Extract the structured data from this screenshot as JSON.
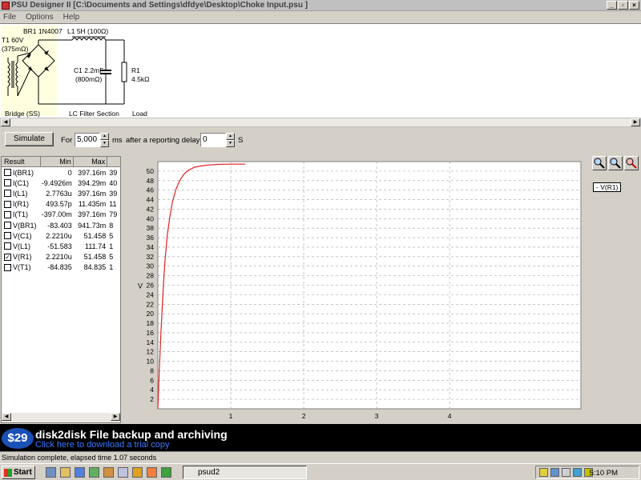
{
  "window": {
    "title": "PSU Designer II  [C:\\Documents and Settings\\dfdye\\Desktop\\Choke Input.psu ]",
    "minimize": "_",
    "maximize": "▫",
    "close": "×"
  },
  "menu": [
    "File",
    "Options",
    "Help"
  ],
  "schematic": {
    "transformer_label": "T1 60V",
    "transformer_resistance": "(375mΩ)",
    "rectifier_label": "BR1 1N4007",
    "inductor_label": "L1 5H (100Ω)",
    "capacitor_label": "C1 2.2mF",
    "capacitor_resistance": "(800mΩ)",
    "load_label": "R1",
    "load_value": "4.5kΩ",
    "section_bridge": "Bridge (SS)",
    "section_filter": "LC Filter Section",
    "section_load": "Load",
    "colors": {
      "bridge_highlight": "#ffffe0",
      "wire": "#000000"
    }
  },
  "simulation": {
    "simulate_button": "Simulate",
    "for_label": "For",
    "duration_value": "5,000",
    "ms_label": "ms",
    "delay_label": "after a reporting delay of",
    "delay_value": "0",
    "s_label": "S"
  },
  "results": {
    "headers": [
      "Result",
      "Min",
      "Max",
      ""
    ],
    "rows": [
      {
        "name": "I(BR1)",
        "min": "0",
        "max": "397.16m",
        "extra": "39",
        "checked": false
      },
      {
        "name": "I(C1)",
        "min": "-9.4926m",
        "max": "394.29m",
        "extra": "40",
        "checked": false
      },
      {
        "name": "I(L1)",
        "min": "2.7763u",
        "max": "397.16m",
        "extra": "39",
        "checked": false
      },
      {
        "name": "I(R1)",
        "min": "493.57p",
        "max": "11.435m",
        "extra": "11",
        "checked": false
      },
      {
        "name": "I(T1)",
        "min": "-397.00m",
        "max": "397.16m",
        "extra": "79",
        "checked": false
      },
      {
        "name": "V(BR1)",
        "min": "-83.403",
        "max": "941.73m",
        "extra": "8",
        "checked": false
      },
      {
        "name": "V(C1)",
        "min": "2.2210u",
        "max": "51.458",
        "extra": "5",
        "checked": false
      },
      {
        "name": "V(L1)",
        "min": "-51.583",
        "max": "111.74",
        "extra": "1",
        "checked": false
      },
      {
        "name": "V(R1)",
        "min": "2.2210u",
        "max": "51.458",
        "extra": "5",
        "checked": true
      },
      {
        "name": "V(T1)",
        "min": "-84.835",
        "max": "84.835",
        "extra": "1",
        "checked": false
      }
    ],
    "check_mark": "✓"
  },
  "zoom_buttons": [
    "zoom-in-icon",
    "zoom-out-icon",
    "zoom-reset-icon"
  ],
  "chart_data": {
    "type": "line",
    "ylabel": "V",
    "xlabel": "",
    "xlim": [
      0,
      5.8
    ],
    "ylim": [
      0,
      52
    ],
    "x_ticks": [
      1,
      2,
      3,
      4
    ],
    "y_ticks": [
      2,
      4,
      6,
      8,
      10,
      12,
      14,
      16,
      18,
      20,
      22,
      24,
      26,
      28,
      30,
      32,
      34,
      36,
      38,
      40,
      42,
      44,
      46,
      48,
      50
    ],
    "grid": true,
    "legend_position": "top-right",
    "series": [
      {
        "name": "V(R1)",
        "color": "#e02020",
        "x": [
          0,
          0.01,
          0.02,
          0.04,
          0.06,
          0.08,
          0.1,
          0.13,
          0.16,
          0.2,
          0.25,
          0.3,
          0.35,
          0.4,
          0.5,
          0.6,
          0.7,
          0.8,
          0.9,
          1.0,
          1.1,
          1.2
        ],
        "y": [
          0,
          4,
          8,
          15,
          21.5,
          27,
          31.5,
          36.5,
          40,
          43.5,
          46.3,
          48,
          49.2,
          50,
          50.8,
          51.1,
          51.3,
          51.4,
          51.45,
          51.46,
          51.46,
          51.46
        ]
      }
    ]
  },
  "legend": {
    "label": "- V(R1)"
  },
  "banner": {
    "price": "$29",
    "title": "disk2disk File backup and archiving",
    "link": "Click here to download a trial copy"
  },
  "status": {
    "text": "Simulation complete, elapsed time 1.07 seconds"
  },
  "taskbar": {
    "start_label": "Start",
    "task_label": "psud2",
    "clock": "5:10 PM"
  }
}
